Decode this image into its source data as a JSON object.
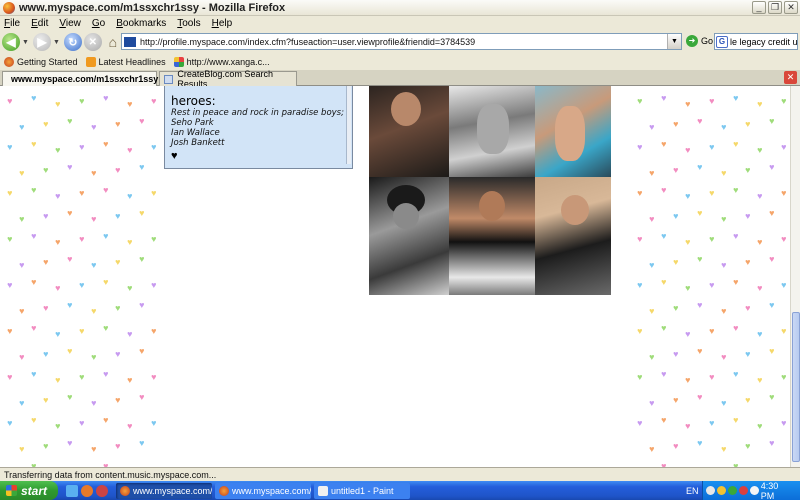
{
  "window": {
    "title": "www.myspace.com/m1ssxchr1ssy - Mozilla Firefox",
    "controls": [
      "_",
      "❐",
      "✕"
    ]
  },
  "menu": [
    {
      "key": "F",
      "rest": "ile"
    },
    {
      "key": "E",
      "rest": "dit"
    },
    {
      "key": "V",
      "rest": "iew"
    },
    {
      "key": "G",
      "rest": "o"
    },
    {
      "key": "B",
      "rest": "ookmarks"
    },
    {
      "key": "T",
      "rest": "ools"
    },
    {
      "key": "H",
      "rest": "elp"
    }
  ],
  "nav": {
    "url": "http://profile.myspace.com/index.cfm?fuseaction=user.viewprofile&friendid=3784539",
    "go_label": "Go",
    "search_value": "le legacy credit union"
  },
  "bookmarks": [
    "Getting Started",
    "Latest Headlines",
    "http://www.xanga.c..."
  ],
  "tabs": [
    {
      "label": "www.myspace.com/m1ssxchr1ssy",
      "active": true
    },
    {
      "label": "CreateBlog.com Search Results",
      "active": false
    }
  ],
  "profile": {
    "heroes_title": "heroes:",
    "heroes_lines": [
      "Rest in peace and rock in paradise boys;",
      "Seho Park",
      "Ian Wallace",
      "Josh Bankett"
    ],
    "heart_symbol": "♥"
  },
  "photos": [
    "photo-1",
    "photo-2",
    "photo-3",
    "photo-4",
    "photo-5",
    "photo-6"
  ],
  "status": "Transferring data from content.music.myspace.com...",
  "taskbar": {
    "start_label": "start",
    "tasks": [
      "www.myspace.com/...",
      "www.myspace.com/...",
      "untitled1 - Paint"
    ],
    "lang": "EN",
    "clock": "4:30 PM"
  },
  "colors": {
    "heroes_bg": "#d2e4f7",
    "heart_palette": [
      "#f28cc0",
      "#7cc8f0",
      "#f5d86a",
      "#9fdc7a",
      "#c79af0",
      "#f5a56a"
    ]
  }
}
